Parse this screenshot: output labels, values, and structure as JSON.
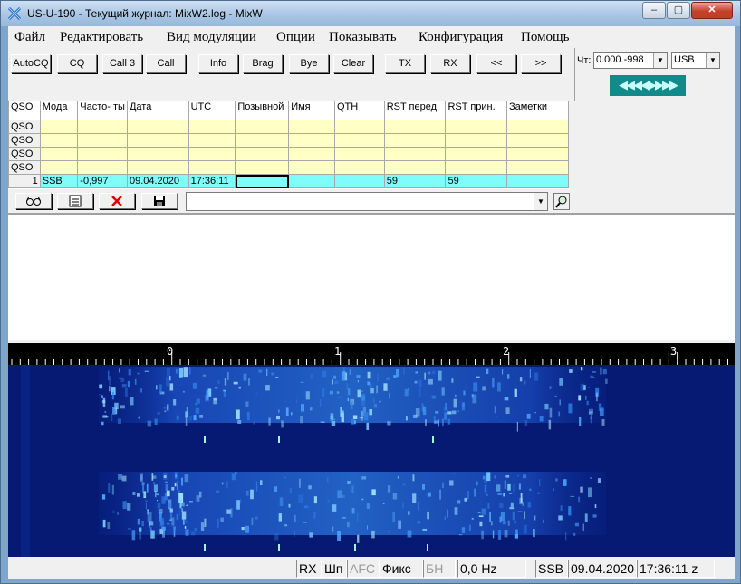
{
  "window": {
    "title": "US-U-190 - Текущий журнал: MixW2.log - MixW",
    "controls": {
      "minimize": "–",
      "maximize": "▢",
      "close": "✕"
    }
  },
  "menu": {
    "items": [
      "Файл",
      "Редактировать",
      "Вид модуляции",
      "Опции",
      "Показывать",
      "Конфигурация",
      "Помощь"
    ]
  },
  "toolbar": {
    "buttons": [
      "AutoCQ",
      "CQ",
      "Call 3",
      "Call",
      "Info",
      "Brag",
      "Bye",
      "Clear",
      "TX",
      "RX",
      "<<",
      ">>"
    ]
  },
  "channel": {
    "label": "Чт:",
    "freq_value": "0.000.-998",
    "mode_value": "USB",
    "tune_arrows": "◀◀◀◀▶▶▶▶"
  },
  "log": {
    "headers": [
      "QSO",
      "Мода",
      "Часто- ты",
      "Дата",
      "UTC",
      "Позывной",
      "Имя",
      "QTH",
      "RST перед.",
      "RST прин.",
      "Заметки"
    ],
    "blank_rows": [
      "QSO",
      "QSO",
      "QSO",
      "QSO"
    ],
    "current_row": {
      "num": "1",
      "mode": "SSB",
      "freq": "-0,997",
      "date": "09.04.2020",
      "utc": "17:36:11",
      "call": "",
      "name": "",
      "qth": "",
      "rst_sent": "59",
      "rst_rcvd": "59",
      "notes": ""
    }
  },
  "icons": {
    "lookup": "glasses-icon",
    "edit": "edit-icon",
    "delete": "delete-icon",
    "save": "save-icon",
    "search": "search-icon"
  },
  "colors": {
    "log_blank_row": "#ffffc6",
    "log_current_row": "#7ffcfc",
    "tune_bar": "#138a8a",
    "waterfall_bg": "#061a73"
  },
  "waterfall": {
    "scale_labels": [
      "0",
      "1",
      "2",
      "3"
    ]
  },
  "status": {
    "rx": "RX",
    "sp": "Шп",
    "afc": "AFC",
    "fix": "Фикс",
    "nb": "БН",
    "offset": "0,0 Hz",
    "mode": "SSB",
    "date": "09.04.2020",
    "time": "17:36:11 z"
  }
}
